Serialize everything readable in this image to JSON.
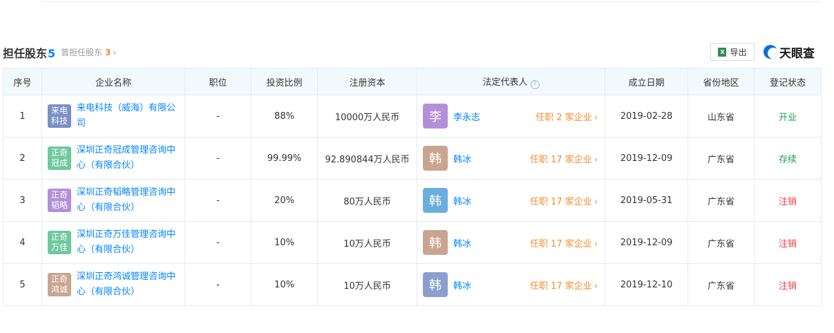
{
  "section": {
    "title": "担任股东",
    "count": "5",
    "former_label": "曾担任股东",
    "former_count": "3",
    "former_chevron": "›",
    "export_label": "导出",
    "excel_icon_glyph": "X",
    "brand": "天眼查"
  },
  "table": {
    "headers": [
      "序号",
      "企业名称",
      "职位",
      "投资比例",
      "注册资本",
      "法定代表人",
      "成立日期",
      "省份地区",
      "登记状态"
    ],
    "help_glyph": "?",
    "rows": [
      {
        "index": "1",
        "badge": "来电科技",
        "badge_color": "#7b8fc7",
        "company": "来电科技（威海）有限公司",
        "position": "-",
        "ratio": "88%",
        "capital": "10000万人民币",
        "rep_avatar": "李",
        "rep_avatar_color": "#b48fd8",
        "rep_name": "李永志",
        "rep_jobs": "任职 2 家企业",
        "date": "2019-02-28",
        "province": "山东省",
        "status": "开业",
        "status_color": "#1e9e4e"
      },
      {
        "index": "2",
        "badge": "正奇冠成",
        "badge_color": "#6fc8a0",
        "company": "深圳正奇冠成管理咨询中心（有限合伙）",
        "position": "-",
        "ratio": "99.99%",
        "capital": "92.890844万人民币",
        "rep_avatar": "韩",
        "rep_avatar_color": "#c9a590",
        "rep_name": "韩冰",
        "rep_jobs": "任职 17 家企业",
        "date": "2019-12-09",
        "province": "广东省",
        "status": "存续",
        "status_color": "#1e9e4e"
      },
      {
        "index": "3",
        "badge": "正奇韬略",
        "badge_color": "#b48fd8",
        "company": "深圳正奇韬略管理咨询中心（有限合伙）",
        "position": "-",
        "ratio": "20%",
        "capital": "80万人民币",
        "rep_avatar": "韩",
        "rep_avatar_color": "#6aaedc",
        "rep_name": "韩冰",
        "rep_jobs": "任职 17 家企业",
        "date": "2019-05-31",
        "province": "广东省",
        "status": "注销",
        "status_color": "#ee3a3a"
      },
      {
        "index": "4",
        "badge": "正奇万佳",
        "badge_color": "#6fc8a0",
        "company": "深圳正奇万佳管理咨询中心（有限合伙）",
        "position": "-",
        "ratio": "10%",
        "capital": "10万人民币",
        "rep_avatar": "韩",
        "rep_avatar_color": "#c9a590",
        "rep_name": "韩冰",
        "rep_jobs": "任职 17 家企业",
        "date": "2019-12-09",
        "province": "广东省",
        "status": "注销",
        "status_color": "#ee3a3a"
      },
      {
        "index": "5",
        "badge": "正奇鸿诚",
        "badge_color": "#c9a590",
        "company": "深圳正奇鸿诚管理咨询中心（有限合伙）",
        "position": "-",
        "ratio": "10%",
        "capital": "10万人民币",
        "rep_avatar": "韩",
        "rep_avatar_color": "#8a9fcf",
        "rep_name": "韩冰",
        "rep_jobs": "任职 17 家企业",
        "date": "2019-12-10",
        "province": "广东省",
        "status": "注销",
        "status_color": "#ee3a3a"
      }
    ]
  }
}
